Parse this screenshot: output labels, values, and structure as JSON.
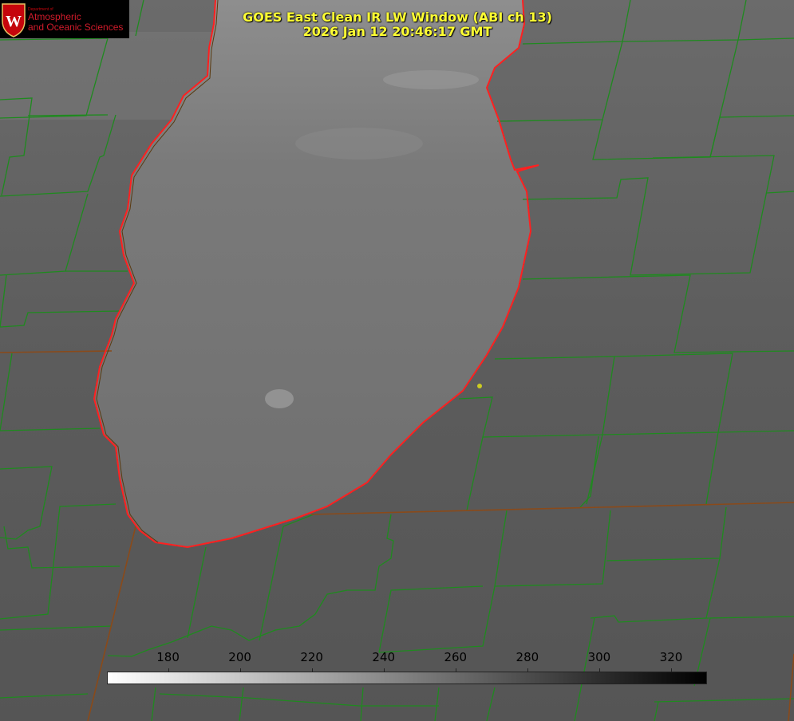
{
  "logo": {
    "department": "Department of",
    "line1": "Atmospheric",
    "line2": "and Oceanic Sciences",
    "crest_letter": "W",
    "crest_color": "#c5050c"
  },
  "title": {
    "line1": "GOES East Clean IR LW Window (ABI ch 13)",
    "line2": "2026 Jan 12 20:46:17 GMT"
  },
  "colorbar": {
    "ticks": [
      "180",
      "200",
      "220",
      "240",
      "260",
      "280",
      "300",
      "320"
    ],
    "range": [
      163,
      330
    ],
    "gradient_start": "#ffffff",
    "gradient_end": "#000000"
  },
  "map_colors": {
    "land": "#5b5b5b",
    "lake": "#777777",
    "county_lines": "#1f8a1f",
    "state_lines": "#8a4a1a",
    "shoreline": "#ff2020",
    "marker": "#cccc22"
  },
  "marker_icon": "location-dot-icon"
}
